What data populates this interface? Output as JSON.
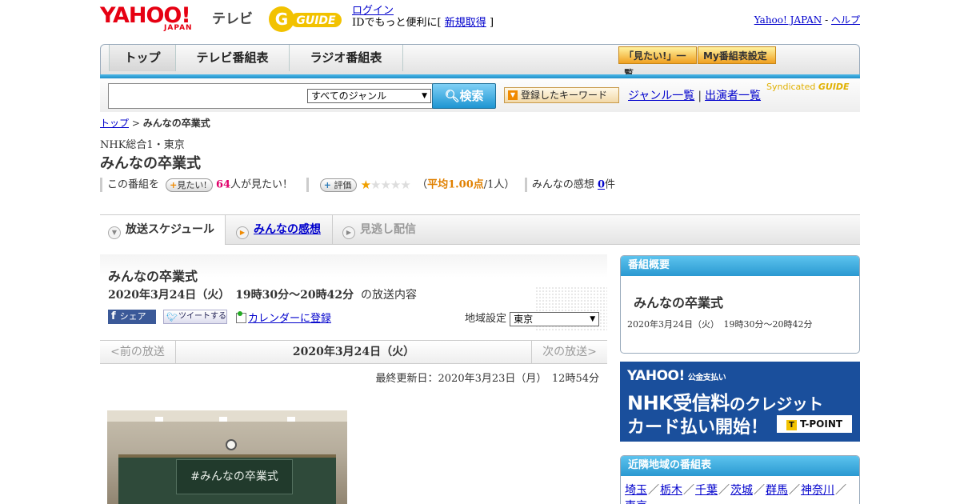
{
  "header": {
    "logo_yahoo": "YAHOO!",
    "logo_japan": "JAPAN",
    "service": "テレビ",
    "gguide": "GUIDE",
    "login_link": "ログイン",
    "login_text_pre": "IDでもっと便利に[",
    "register_link": "新規取得",
    "login_text_post": "]",
    "yahoo_japan_link": "Yahoo! JAPAN",
    "separator": "-",
    "help_link": "ヘルプ"
  },
  "nav": {
    "tabs": [
      "トップ",
      "テレビ番組表",
      "ラジオ番組表"
    ],
    "mitai_list": "「見たい!」一覧",
    "my_schedule": "My番組表設定"
  },
  "search": {
    "genre_selected": "すべてのジャンル",
    "button": "検索",
    "keyword_button": "登録したキーワード",
    "genre_list_link": "ジャンル一覧",
    "divider": "|",
    "performer_link": "出演者一覧",
    "syndicated": "Syndicated",
    "syndicated_g": "GUIDE"
  },
  "breadcrumb": {
    "top": "トップ",
    "sep": ">",
    "current": "みんなの卒業式"
  },
  "program": {
    "station": "NHK総合1・東京",
    "title": "みんなの卒業式",
    "this_program": "この番組を",
    "mitai_btn": "見たい!",
    "mitai_count": "64",
    "mitai_suffix": "人が見たい！",
    "rate_btn": "評価",
    "rating_value": 1,
    "rating_max": 5,
    "avg_pre": "（",
    "avg_text": "平均1.00点",
    "avg_post": "/1人）",
    "impressions_label": "みんなの感想",
    "impressions_count": "0",
    "impressions_suffix": "件"
  },
  "subtabs": {
    "schedule": "放送スケジュール",
    "impressions": "みんなの感想",
    "missed": "見逃し配信"
  },
  "main": {
    "title": "みんなの卒業式",
    "date_bold": "2020年3月24日（火）　19時30分～20時42分",
    "date_suffix": "の放送内容",
    "share_fb": "シェア",
    "share_fb_icon": "f",
    "tweet": "ツイートする",
    "calendar": "カレンダーに登録",
    "region_label": "地域設定",
    "region_value": "東京",
    "prev": "<前の放送",
    "current_day": "2020年3月24日（火）",
    "next": "次の放送>",
    "updated": "最終更新日：2020年3月23日（月）　12時54分",
    "thumb_text": "#みんなの卒業式"
  },
  "side": {
    "summary_header": "番組概要",
    "summary_title": "みんなの卒業式",
    "summary_date": "2020年3月24日（火）　19時30分～20時42分",
    "banner_brand": "YAHOO!",
    "banner_sub": "公金支払い",
    "banner_line1a": "NHK受信料",
    "banner_line1b": "のクレジット",
    "banner_line2": "カード払い開始！",
    "banner_tpoint": "T-POINT",
    "nearby_header": "近隣地域の番組表",
    "nearby": [
      "埼玉",
      "栃木",
      "千葉",
      "茨城",
      "群馬",
      "神奈川",
      "東京"
    ],
    "nearby_sep": "／"
  },
  "colors": {
    "accent_blue": "#2a99d1",
    "yahoo_red": "#e60012",
    "link": "#0000cc",
    "star_on": "#f0a000"
  }
}
